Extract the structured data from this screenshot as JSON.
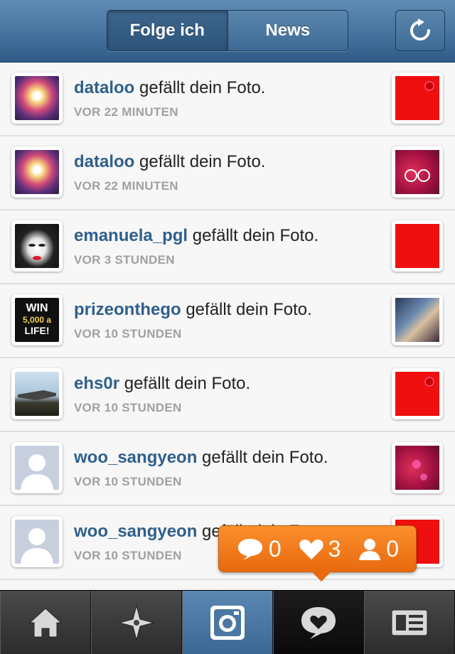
{
  "header": {
    "segments": [
      "Folge ich",
      "News"
    ],
    "active_segment": "Folge ich",
    "refresh_icon": "refresh-icon"
  },
  "feed": [
    {
      "user": "dataloo",
      "action": " gefällt dein Foto.",
      "time": "VOR 22 MINUTEN"
    },
    {
      "user": "dataloo",
      "action": " gefällt dein Foto.",
      "time": "VOR 22 MINUTEN"
    },
    {
      "user": "emanuela_pgl",
      "action": " gefällt dein Foto.",
      "time": "VOR 3 STUNDEN"
    },
    {
      "user": "prizeonthego",
      "action": " gefällt dein Foto.",
      "time": "VOR 10 STUNDEN"
    },
    {
      "user": "ehs0r",
      "action": " gefällt dein Foto.",
      "time": "VOR 10 STUNDEN"
    },
    {
      "user": "woo_sangyeon",
      "action": " gefällt dein Foto.",
      "time": "VOR 10 STUNDEN"
    },
    {
      "user": "woo_sangyeon",
      "action": " gefällt dein Foto.",
      "time": "VOR 10 STUNDEN"
    }
  ],
  "avatar_text": {
    "win_line1": "WIN",
    "win_line2": "5,000 a",
    "win_line3": "LIFE!"
  },
  "notification_bubble": {
    "comments": "0",
    "likes": "3",
    "followers": "0",
    "color": "#f07a18"
  },
  "tabbar": {
    "tabs": [
      "home-icon",
      "explore-icon",
      "camera-icon",
      "news-icon",
      "profile-icon"
    ],
    "active": "news-icon"
  },
  "colors": {
    "header_blue": "#4a78a2",
    "username_blue": "#2f5f8c",
    "time_gray": "#a0a0a0"
  }
}
